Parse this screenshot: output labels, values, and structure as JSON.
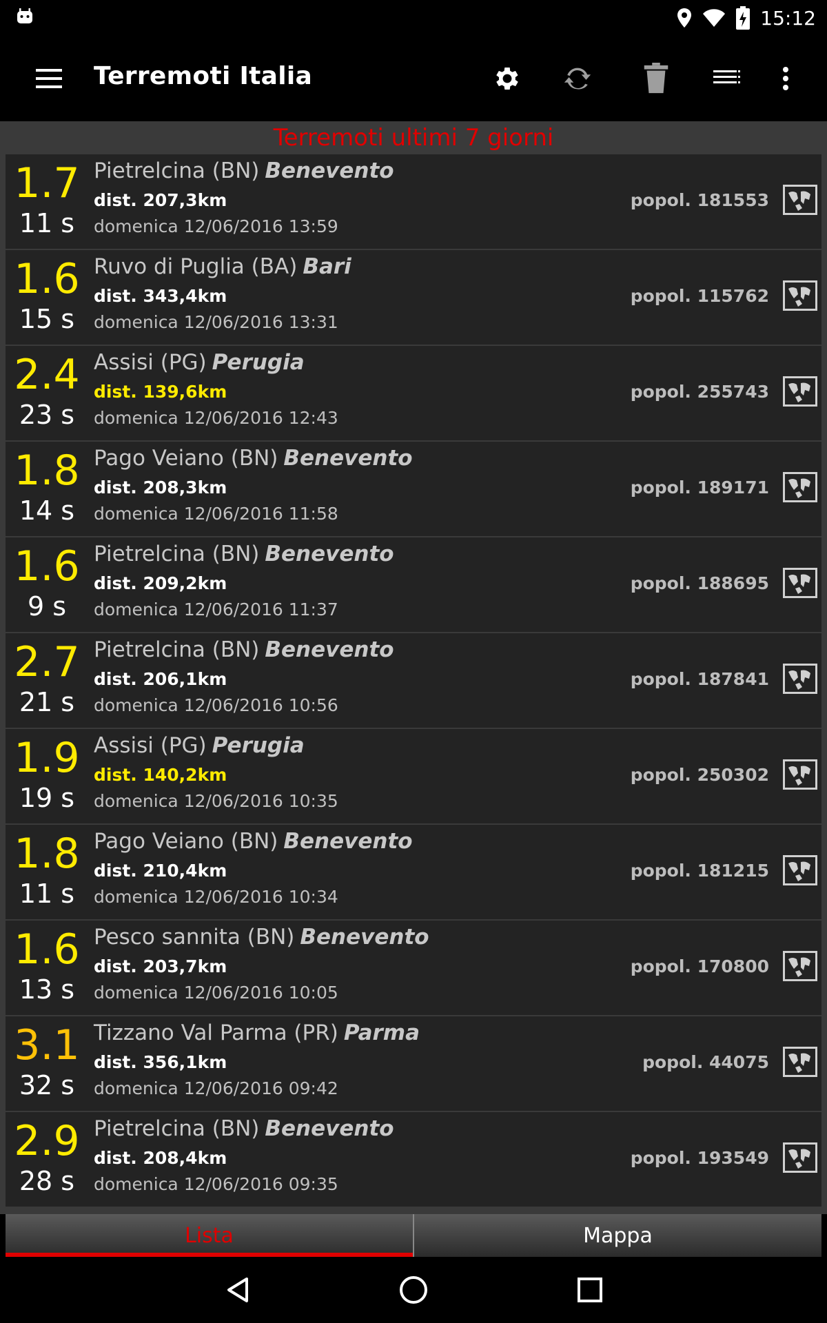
{
  "status": {
    "time": "15:12"
  },
  "appbar": {
    "title": "Terremoti Italia",
    "icons": [
      "menu-icon",
      "settings-icon",
      "refresh-icon",
      "trash-icon",
      "list-icon",
      "more-vert-icon"
    ]
  },
  "header": {
    "text": "Terremoti ultimi 7 giorni"
  },
  "colors": {
    "accent": "#e00000",
    "mag_yellow": "#ffeb00",
    "mag_orange": "#ffc107",
    "dist_yellow": "#ffeb00"
  },
  "quakes": [
    {
      "mag": "1.7",
      "dur": "11 s",
      "place": "Pietrelcina (BN)",
      "province": "Benevento",
      "dist": "dist. 207,3km",
      "pop": "popol. 181553",
      "date": "domenica 12/06/2016 13:59",
      "mag_color": "#ffeb00",
      "dist_color": "#ffffff"
    },
    {
      "mag": "1.6",
      "dur": "15 s",
      "place": "Ruvo di Puglia (BA)",
      "province": "Bari",
      "dist": "dist. 343,4km",
      "pop": "popol. 115762",
      "date": "domenica 12/06/2016 13:31",
      "mag_color": "#ffeb00",
      "dist_color": "#ffffff"
    },
    {
      "mag": "2.4",
      "dur": "23 s",
      "place": "Assisi (PG)",
      "province": "Perugia",
      "dist": "dist. 139,6km",
      "pop": "popol. 255743",
      "date": "domenica 12/06/2016 12:43",
      "mag_color": "#ffeb00",
      "dist_color": "#ffeb00"
    },
    {
      "mag": "1.8",
      "dur": "14 s",
      "place": "Pago Veiano (BN)",
      "province": "Benevento",
      "dist": "dist. 208,3km",
      "pop": "popol. 189171",
      "date": "domenica 12/06/2016 11:58",
      "mag_color": "#ffeb00",
      "dist_color": "#ffffff"
    },
    {
      "mag": "1.6",
      "dur": "9 s",
      "place": "Pietrelcina (BN)",
      "province": "Benevento",
      "dist": "dist. 209,2km",
      "pop": "popol. 188695",
      "date": "domenica 12/06/2016 11:37",
      "mag_color": "#ffeb00",
      "dist_color": "#ffffff"
    },
    {
      "mag": "2.7",
      "dur": "21 s",
      "place": "Pietrelcina (BN)",
      "province": "Benevento",
      "dist": "dist. 206,1km",
      "pop": "popol. 187841",
      "date": "domenica 12/06/2016 10:56",
      "mag_color": "#ffeb00",
      "dist_color": "#ffffff"
    },
    {
      "mag": "1.9",
      "dur": "19 s",
      "place": "Assisi (PG)",
      "province": "Perugia",
      "dist": "dist. 140,2km",
      "pop": "popol. 250302",
      "date": "domenica 12/06/2016 10:35",
      "mag_color": "#ffeb00",
      "dist_color": "#ffeb00"
    },
    {
      "mag": "1.8",
      "dur": "11 s",
      "place": "Pago Veiano (BN)",
      "province": "Benevento",
      "dist": "dist. 210,4km",
      "pop": "popol. 181215",
      "date": "domenica 12/06/2016 10:34",
      "mag_color": "#ffeb00",
      "dist_color": "#ffffff"
    },
    {
      "mag": "1.6",
      "dur": "13 s",
      "place": "Pesco sannita (BN)",
      "province": "Benevento",
      "dist": "dist. 203,7km",
      "pop": "popol. 170800",
      "date": "domenica 12/06/2016 10:05",
      "mag_color": "#ffeb00",
      "dist_color": "#ffffff"
    },
    {
      "mag": "3.1",
      "dur": "32 s",
      "place": "Tizzano Val Parma (PR)",
      "province": "Parma",
      "dist": "dist. 356,1km",
      "pop": "popol. 44075",
      "date": "domenica 12/06/2016 09:42",
      "mag_color": "#ffc107",
      "dist_color": "#ffffff"
    },
    {
      "mag": "2.9",
      "dur": "28 s",
      "place": "Pietrelcina (BN)",
      "province": "Benevento",
      "dist": "dist. 208,4km",
      "pop": "popol. 193549",
      "date": "domenica 12/06/2016 09:35",
      "mag_color": "#ffeb00",
      "dist_color": "#ffffff"
    }
  ],
  "tabs": [
    {
      "label": "Lista",
      "active": true
    },
    {
      "label": "Mappa",
      "active": false
    }
  ]
}
